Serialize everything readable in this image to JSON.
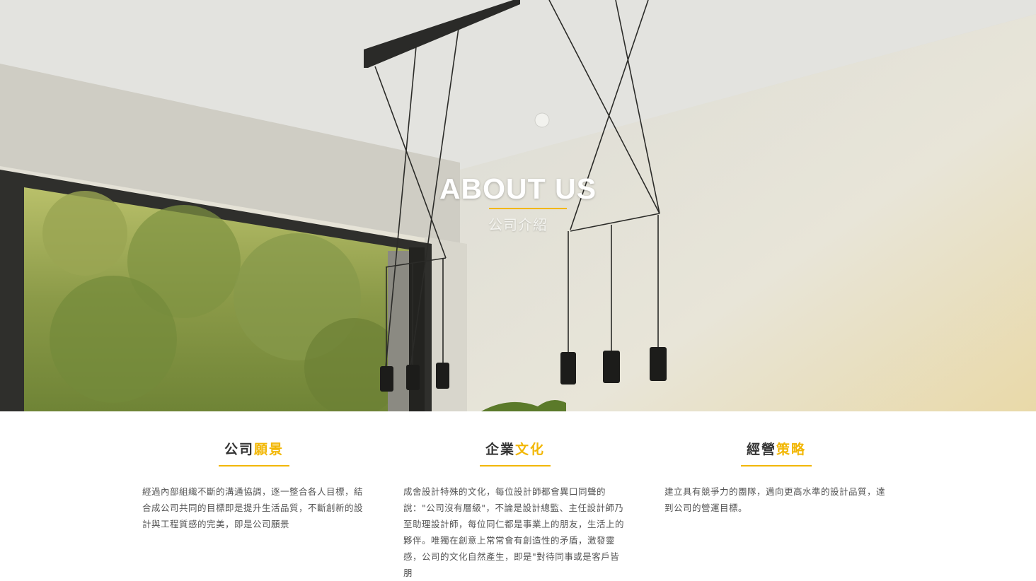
{
  "hero": {
    "title": "ABOUT US",
    "subtitle": "公司介紹"
  },
  "colors": {
    "accent": "#f2b705",
    "heading": "#333333",
    "body_text": "#555555"
  },
  "columns": [
    {
      "title_main": "公司",
      "title_accent": "願景",
      "text": "經過內部組織不斷的溝通協調，逐一整合各人目標，結合成公司共同的目標即是提升生活品質，不斷創新的設計與工程質感的完美，即是公司願景"
    },
    {
      "title_main": "企業",
      "title_accent": "文化",
      "text": "成舍設計特殊的文化，每位設計師都會異口同聲的說：\"公司沒有層級\"，不論是設計總監、主任設計師乃至助理設計師，每位同仁都是事業上的朋友，生活上的夥伴。唯獨在創意上常常會有創造性的矛盾，激發靈感，公司的文化自然產生，即是\"對待同事或是客戶皆朋"
    },
    {
      "title_main": "經營",
      "title_accent": "策略",
      "text": "建立具有競爭力的團隊，邁向更高水準的設計品質，達到公司的營運目標。"
    }
  ]
}
